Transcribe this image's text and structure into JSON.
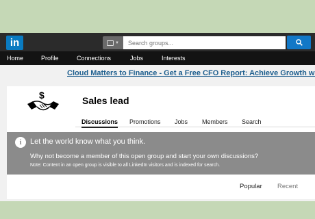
{
  "logo": {
    "text": "in"
  },
  "search": {
    "placeholder": "Search groups..."
  },
  "nav": {
    "items": [
      "Home",
      "Profile",
      "Connections",
      "Jobs",
      "Interests"
    ]
  },
  "ad": {
    "text": "Cloud Matters to Finance - Get a Free CFO Report: Achieve Growth with Clo"
  },
  "group": {
    "title": "Sales lead",
    "tabs": [
      "Discussions",
      "Promotions",
      "Jobs",
      "Members",
      "Search"
    ]
  },
  "banner": {
    "icon": "i",
    "heading": "Let the world know what you think.",
    "question": "Why not become a member of this open group and start your own discussions?",
    "note": "Note: Content in an open group is visible to all LinkedIn visitors and is indexed for search."
  },
  "sort": {
    "popular": "Popular",
    "recent": "Recent"
  },
  "colors": {
    "brand": "#0a7bc1",
    "banner": "#8b8b8b",
    "link": "#1d5e8e"
  }
}
